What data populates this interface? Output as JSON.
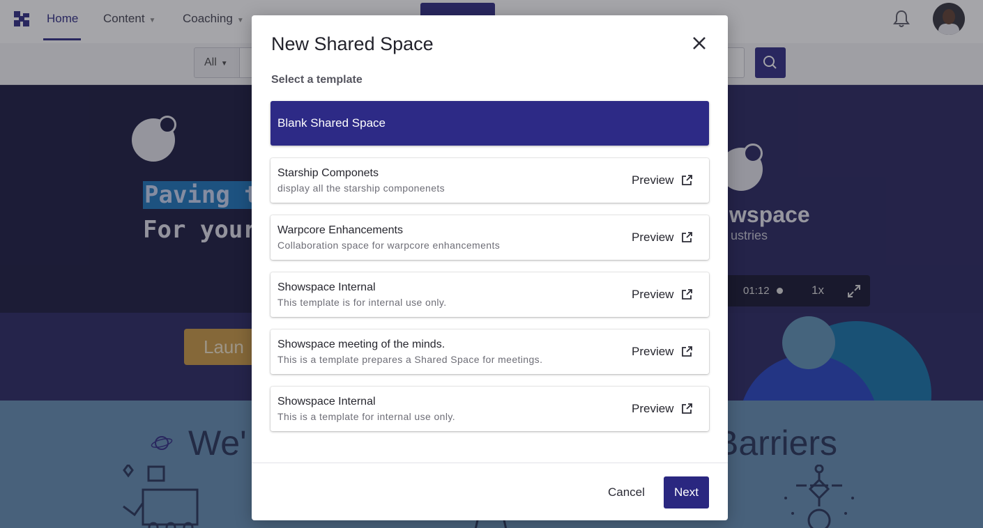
{
  "nav": {
    "items": [
      {
        "label": "Home"
      },
      {
        "label": "Content"
      },
      {
        "label": "Coaching"
      }
    ]
  },
  "search": {
    "scope_label": "All",
    "placeholder": ""
  },
  "hero": {
    "headline_line1": "Paving t",
    "headline_line2": "For your",
    "brand_name": "wspace",
    "brand_sub": "ustries",
    "video": {
      "time": "01:12",
      "speed": "1x"
    }
  },
  "band": {
    "launch_label": "Laun"
  },
  "lower": {
    "heading_left": "We'",
    "heading_right": "Barriers"
  },
  "modal": {
    "title": "New Shared Space",
    "subheading": "Select a template",
    "templates": [
      {
        "name": "Blank Shared Space",
        "description": "",
        "selected": true
      },
      {
        "name": "Starship Componets",
        "description": "display all the starship componenets",
        "preview_label": "Preview"
      },
      {
        "name": "Warpcore Enhancements",
        "description": "Collaboration space for warpcore enhancements",
        "preview_label": "Preview"
      },
      {
        "name": "Showspace Internal",
        "description": "This template is for internal use only.",
        "preview_label": "Preview"
      },
      {
        "name": "Showspace meeting of the minds.",
        "description": "This is a template prepares a Shared Space for meetings.",
        "preview_label": "Preview"
      },
      {
        "name": "Showspace Internal",
        "description": "This is a template for internal use only.",
        "preview_label": "Preview"
      }
    ],
    "cancel_label": "Cancel",
    "next_label": "Next"
  },
  "colors": {
    "primary": "#2a2780",
    "selected_template": "#2d2a86",
    "overlay": "rgba(40,40,50,0.42)"
  },
  "icons": [
    "logo-icon",
    "bell-icon",
    "search-icon",
    "close-icon",
    "external-link-icon",
    "expand-icon",
    "orbit-icon"
  ]
}
